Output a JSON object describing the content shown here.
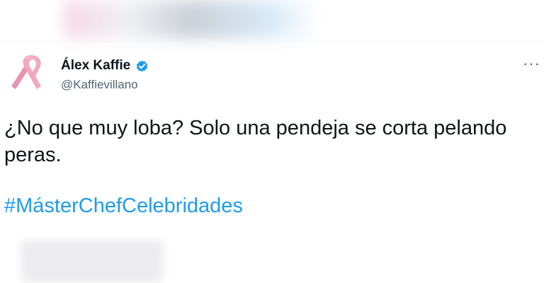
{
  "tweet": {
    "author": {
      "display_name": "Álex Kaffie",
      "handle": "@Kaffievillano",
      "verified": true,
      "avatar_icon": "pink-ribbon-icon"
    },
    "more_label": "···",
    "text": "¿No que muy loba? Solo una pendeja se corta pelando peras.",
    "hashtag": "#MásterChefCelebridades"
  },
  "colors": {
    "link": "#1d9bf0",
    "verified": "#1d9bf0",
    "secondary_text": "#536471",
    "ribbon": "#f2a7bd"
  }
}
